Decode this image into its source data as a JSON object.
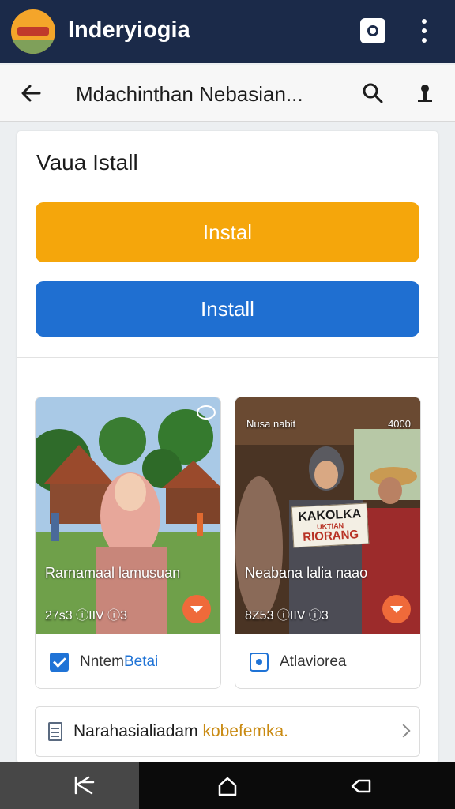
{
  "app": {
    "title": "Inderyiogia"
  },
  "toolbar": {
    "title": "Mdachinthan Nebasian..."
  },
  "card": {
    "heading": "Vaua Istall",
    "install_primary_label": "Instal",
    "install_secondary_label": "Install"
  },
  "gallery": [
    {
      "caption": "Rarnamaal lamusuan",
      "stats": "27s3 ⓘIIV ⓘ3",
      "footer_label_a": "Nntem",
      "footer_label_b": "Betai"
    },
    {
      "tag": "Nusa nabit",
      "count": "4000",
      "sign_line1": "KAKOLKA",
      "sign_line2": "UKTIAN",
      "sign_line3": "RIORANG",
      "caption": "Neabana lalia naao",
      "stats": "8Z53 ⓘIIV ⓘ3",
      "footer_label": "Atlaviorea"
    }
  ],
  "list_row": {
    "text_a": "Narahasialiadam",
    "text_b": "kobefemka."
  },
  "colors": {
    "appbar": "#1b2a49",
    "install_primary": "#f5a60b",
    "install_secondary": "#1f6fd1",
    "favorite_badge": "#ef6a3a"
  },
  "icons": [
    "logo",
    "camera-icon",
    "more-vert-icon",
    "back-arrow-icon",
    "search-icon",
    "account-icon",
    "checkbox-icon",
    "share-icon",
    "document-icon",
    "chevron-right-icon",
    "nav-recents-icon",
    "nav-home-icon",
    "nav-back-icon"
  ]
}
